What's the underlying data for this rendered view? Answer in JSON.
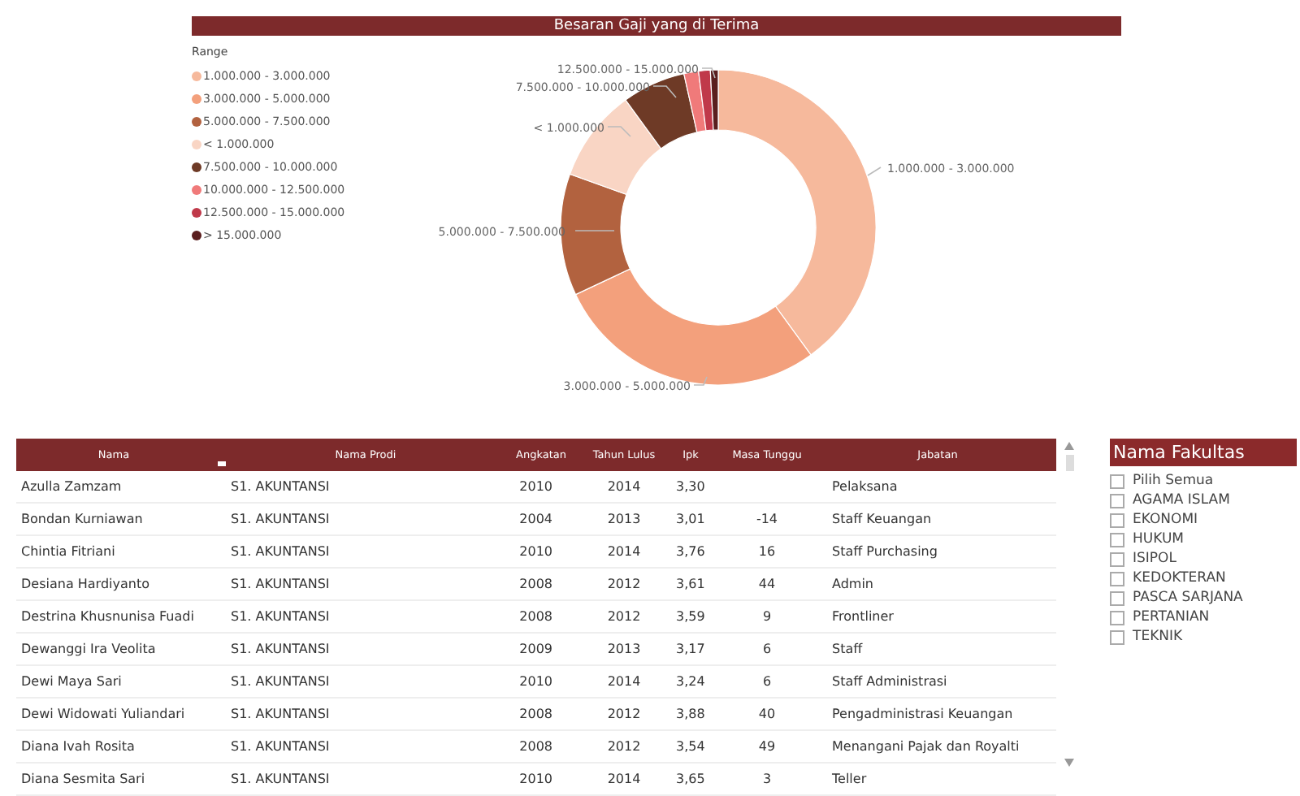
{
  "salary_chart": {
    "title": "Besaran Gaji yang di Terima",
    "legend_title": "Range",
    "legend": [
      {
        "label": "1.000.000 - 3.000.000",
        "color": "#f6b99c"
      },
      {
        "label": "3.000.000 - 5.000.000",
        "color": "#f3a07c"
      },
      {
        "label": "5.000.000 - 7.500.000",
        "color": "#b2623f"
      },
      {
        "label": "< 1.000.000",
        "color": "#f9d5c4"
      },
      {
        "label": "7.500.000 - 10.000.000",
        "color": "#6e3a26"
      },
      {
        "label": "10.000.000 - 12.500.000",
        "color": "#f07a7a"
      },
      {
        "label": "12.500.000 - 15.000.000",
        "color": "#c0394a"
      },
      {
        "label": "> 15.000.000",
        "color": "#5a1e1e"
      }
    ],
    "slice_labels": [
      "12.500.000 - 15.000.000",
      "7.500.000 - 10.000.000",
      "< 1.000.000",
      "5.000.000 - 7.500.000",
      "1.000.000 - 3.000.000",
      "3.000.000 - 5.000.000"
    ]
  },
  "table": {
    "columns": [
      "Nama",
      "Nama Prodi",
      "Angkatan",
      "Tahun Lulus",
      "Ipk",
      "Masa Tunggu",
      "Jabatan"
    ],
    "rows": [
      [
        "Azulla Zamzam",
        "S1. AKUNTANSI",
        "2010",
        "2014",
        "3,30",
        "",
        "Pelaksana"
      ],
      [
        "Bondan Kurniawan",
        "S1. AKUNTANSI",
        "2004",
        "2013",
        "3,01",
        "-14",
        "Staff Keuangan"
      ],
      [
        "Chintia Fitriani",
        "S1. AKUNTANSI",
        "2010",
        "2014",
        "3,76",
        "16",
        "Staff Purchasing"
      ],
      [
        "Desiana Hardiyanto",
        "S1. AKUNTANSI",
        "2008",
        "2012",
        "3,61",
        "44",
        "Admin"
      ],
      [
        "Destrina Khusnunisa Fuadi",
        "S1. AKUNTANSI",
        "2008",
        "2012",
        "3,59",
        "9",
        "Frontliner"
      ],
      [
        "Dewanggi Ira Veolita",
        "S1. AKUNTANSI",
        "2009",
        "2013",
        "3,17",
        "6",
        "Staff"
      ],
      [
        "Dewi Maya Sari",
        "S1. AKUNTANSI",
        "2010",
        "2014",
        "3,24",
        "6",
        "Staff Administrasi"
      ],
      [
        "Dewi Widowati Yuliandari",
        "S1. AKUNTANSI",
        "2008",
        "2012",
        "3,88",
        "40",
        "Pengadministrasi Keuangan"
      ],
      [
        "Diana Ivah Rosita",
        "S1. AKUNTANSI",
        "2008",
        "2012",
        "3,54",
        "49",
        "Menangani Pajak dan Royalti"
      ],
      [
        "Diana Sesmita Sari",
        "S1. AKUNTANSI",
        "2010",
        "2014",
        "3,65",
        "3",
        "Teller"
      ]
    ]
  },
  "slicer": {
    "title": "Nama Fakultas",
    "items": [
      {
        "label": "Pilih Semua",
        "checked": false
      },
      {
        "label": "AGAMA ISLAM",
        "checked": false
      },
      {
        "label": "EKONOMI",
        "checked": false
      },
      {
        "label": "HUKUM",
        "checked": false
      },
      {
        "label": "ISIPOL",
        "checked": false
      },
      {
        "label": "KEDOKTERAN",
        "checked": false
      },
      {
        "label": "PASCA SARJANA",
        "checked": false
      },
      {
        "label": "PERTANIAN",
        "checked": false
      },
      {
        "label": "TEKNIK",
        "checked": false
      }
    ]
  }
}
